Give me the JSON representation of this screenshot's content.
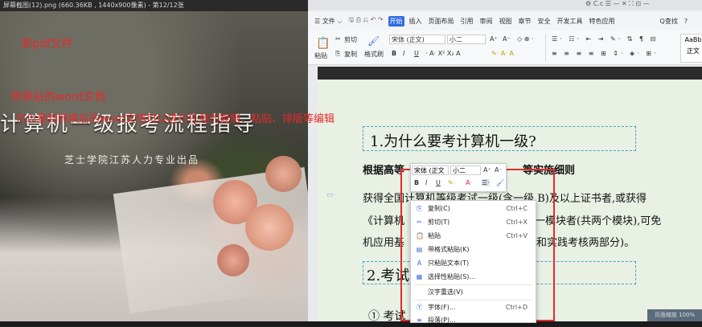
{
  "viewer": {
    "title": "屏幕截图(12).png (660.36KB , 1440x900像素) - 第12/12张",
    "label_original": "原pdf文件",
    "book_title": "计算机一级报考流程指导",
    "book_subtitle": "芝士学院江苏人力专业出品"
  },
  "wps": {
    "top_icons": "⚙ C.c   ☰  —  ✕  ⛶  ⊡  —",
    "menu_file": "☰ 文件 ⌵",
    "tabs": [
      "开始",
      "插入",
      "页面布局",
      "引用",
      "审阅",
      "视图",
      "章节",
      "安全",
      "开发工具",
      "特色应用"
    ],
    "active_tab": "开始",
    "search_label": "Q查找",
    "help": "?",
    "ribbon": {
      "cut": "剪切",
      "paste": "粘贴",
      "copy": "复制",
      "format_painter": "格式刷",
      "font": "宋体 (正文)",
      "size": "小二",
      "font_grow": "A⁺",
      "font_shrink": "A⁻",
      "bold": "B",
      "italic": "I",
      "underline": "U",
      "style_preview": "AaBb",
      "style_name": "正文"
    }
  },
  "document": {
    "caption_converted": "转换后的word文档",
    "caption_note": "可以看到转换后的word文档可以进行任意的复制、粘贴、排版等编辑",
    "heading1": "1.为什么要考计算机一级?",
    "subheading_left": "根据高等",
    "subheading_right": "等实施细则",
    "para_line1": "获得全国计算机等级考试一级(含一级 B)及以上证书者,或获得",
    "para_line2": "《计算机",
    "para_line2_right": "任一模块者(共两个模块),可免",
    "para_line3_red": "机应用基",
    "para_line3_right": "和实践考核两部分)。",
    "heading2": "2.考试",
    "list_item": "① 考试"
  },
  "mini_toolbar": {
    "font": "宋体 (正文",
    "size": "小二",
    "grow": "A⁺",
    "shrink": "A⁻",
    "bold": "B",
    "italic": "I",
    "underline": "U"
  },
  "context_menu": [
    {
      "label": "复制(C)",
      "shortcut": "Ctrl+C",
      "icon": "copy-icon"
    },
    {
      "label": "剪切(T)",
      "shortcut": "Ctrl+X",
      "icon": "scissors-icon"
    },
    {
      "label": "粘贴",
      "shortcut": "Ctrl+V",
      "icon": "paste-icon"
    },
    {
      "label": "带格式粘贴(K)",
      "shortcut": "",
      "icon": "paste-format-icon"
    },
    {
      "label": "只粘贴文本(T)",
      "shortcut": "",
      "icon": "paste-text-icon"
    },
    {
      "label": "选择性粘贴(S)...",
      "shortcut": "",
      "icon": "paste-special-icon"
    },
    {
      "label": "汉字重选(V)",
      "shortcut": "",
      "icon": ""
    },
    {
      "label": "字体(F)...",
      "shortcut": "Ctrl+D",
      "icon": "font-icon"
    },
    {
      "label": "段落(P)...",
      "shortcut": "",
      "icon": "paragraph-icon"
    }
  ],
  "zoom_pill": "页面缩放 100%",
  "colors": {
    "accent": "#2f6be4",
    "annotation_red": "#e32b2b",
    "doc_bg": "#e8f1e4"
  }
}
